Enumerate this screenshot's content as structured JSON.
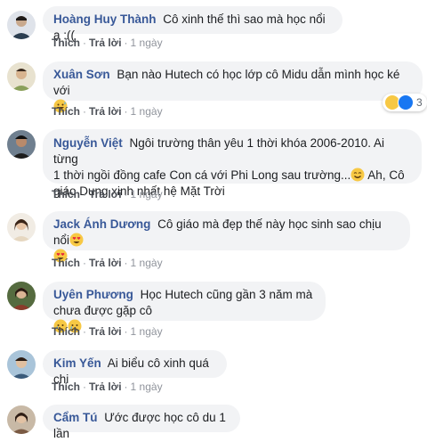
{
  "actions": {
    "like": "Thích",
    "reply": "Trả lời",
    "dot": "·"
  },
  "comments": [
    {
      "author": "Hoàng Huy Thành",
      "text": "Cô xinh thế thì sao mà học nổi ạ :((",
      "time": "1 ngày"
    },
    {
      "author": "Xuân Sơn",
      "text": "Bạn nào Hutech có học lớp cô Midu dẫn mình học ké với",
      "time": "1 ngày",
      "emoji": "grinning-sweat-face",
      "reaction_count": "3",
      "reaction_icons": [
        "laughing-face-icon",
        "like-icon"
      ]
    },
    {
      "author": "Nguyễn Việt",
      "text_lines": [
        "Ngôi trường thân yêu 1 thời khóa 2006-2010. Ai từng",
        "1 thời ngồi đồng cafe Con cá với Phi Long sau trường...",
        "giáo Dung xinh nhất hệ Mặt Trời"
      ],
      "text_after_emoji": " Ah, Cô",
      "time": "1 ngày"
    },
    {
      "author": "Jack Ánh Dương",
      "text": "Cô giáo mà đẹp thế này học sinh sao chịu nổi",
      "time": "1 ngày"
    },
    {
      "author": "Uyên Phương",
      "text": "Học Hutech cũng gần 3 năm mà chưa được gặp cô",
      "time": "1 ngày"
    },
    {
      "author": "Kim Yến",
      "text": "Ai biểu cô xinh quá chi",
      "time": "1 ngày"
    },
    {
      "author": "Cẩm Tú",
      "text": "Ước được học cô du 1 lần"
    }
  ],
  "colors": {
    "author": "#385898",
    "bubble": "#f2f3f5",
    "meta": "#606770"
  }
}
